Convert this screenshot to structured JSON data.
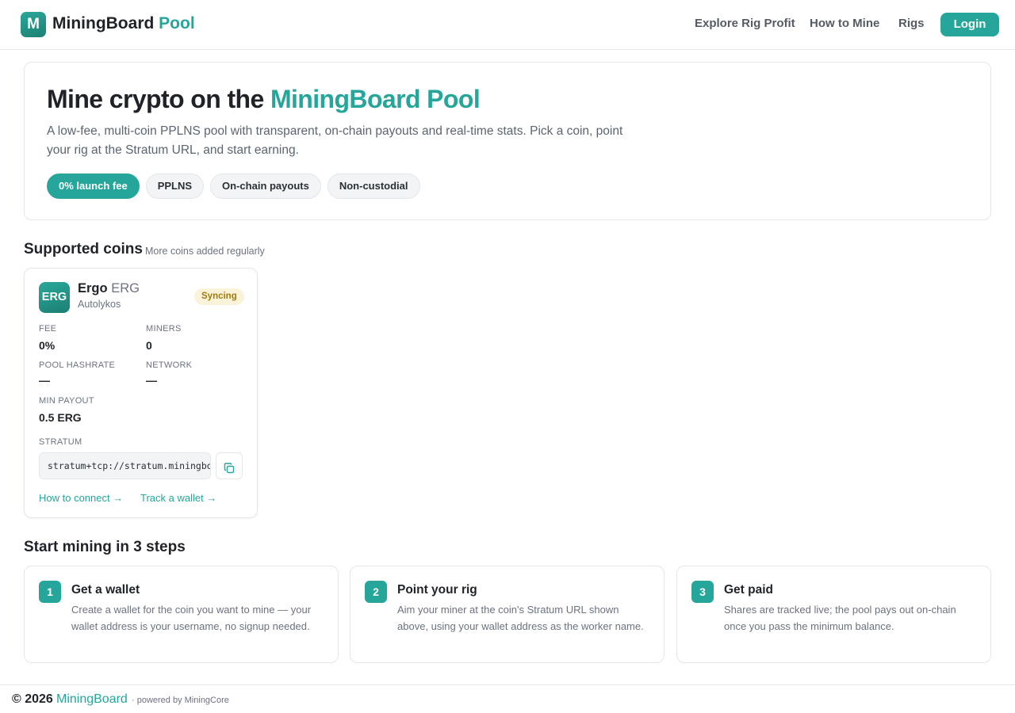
{
  "header": {
    "logo_letter": "M",
    "brand_name": "MiningBoard",
    "brand_accent": "Pool",
    "nav": {
      "explore": "Explore Rig Profit",
      "how_to": "How to Mine",
      "rigs": "Rigs"
    },
    "login_label": "Login"
  },
  "hero": {
    "title_prefix": "Mine crypto on the",
    "title_accent": "MiningBoard Pool",
    "description": "A low-fee, multi-coin PPLNS pool with transparent, on-chain payouts and real-time stats. Pick a coin, point your rig at the Stratum URL, and start earning.",
    "pills": [
      "0% launch fee",
      "PPLNS",
      "On-chain payouts",
      "Non-custodial"
    ]
  },
  "coins": {
    "title": "Supported coins",
    "subtitle": "More coins added regularly",
    "card": {
      "logo_text": "ERG",
      "name": "Ergo",
      "ticker": "ERG",
      "algorithm": "Autolykos",
      "status": "Syncing",
      "stats": {
        "fee_label": "FEE",
        "fee_value": "0%",
        "miners_label": "MINERS",
        "miners_value": "0",
        "pool_hashrate_label": "POOL HASHRATE",
        "pool_hashrate_value": "—",
        "network_label": "NETWORK",
        "network_value": "—",
        "min_payout_label": "MIN PAYOUT",
        "min_payout_value": "0.5 ERG"
      },
      "stratum_label": "STRATUM",
      "stratum_url": "stratum+tcp://stratum.miningboard.pool",
      "links": {
        "how_to_connect": "How to connect →",
        "track_wallet": "Track a wallet →"
      }
    }
  },
  "steps": {
    "title": "Start mining in 3 steps",
    "items": [
      {
        "number": "1",
        "title": "Get a wallet",
        "description": "Create a wallet for the coin you want to mine — your wallet address is your username, no signup needed."
      },
      {
        "number": "2",
        "title": "Point your rig",
        "description": "Aim your miner at the coin's Stratum URL shown above, using your wallet address as the worker name."
      },
      {
        "number": "3",
        "title": "Get paid",
        "description": "Shares are tracked live; the pool pays out on-chain once you pass the minimum balance."
      }
    ]
  },
  "footer": {
    "copyright": "© 2026",
    "brand": "MiningBoard",
    "powered_by": "· powered by MiningCore"
  },
  "colors": {
    "accent": "#26a69a",
    "status_syncing_bg": "#fbf3d9",
    "status_syncing_text": "#a47a0c"
  },
  "icons": {
    "copy_button": "copy-icon"
  }
}
